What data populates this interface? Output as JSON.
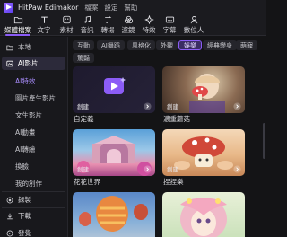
{
  "titlebar": {
    "app_name": "HitPaw Edimakor",
    "menus": [
      "檔案",
      "設定",
      "幫助"
    ]
  },
  "toolbar": {
    "items": [
      {
        "label": "媒體檔案",
        "icon": "folder-icon"
      },
      {
        "label": "文字",
        "icon": "text-icon"
      },
      {
        "label": "素材",
        "icon": "sticker-icon"
      },
      {
        "label": "音訊",
        "icon": "music-icon"
      },
      {
        "label": "轉場",
        "icon": "transition-icon"
      },
      {
        "label": "濾鏡",
        "icon": "filter-icon"
      },
      {
        "label": "特效",
        "icon": "effects-icon"
      },
      {
        "label": "字幕",
        "icon": "subtitle-icon"
      },
      {
        "label": "數位人",
        "icon": "digital-human-icon"
      }
    ]
  },
  "sidebar": {
    "local": "本地",
    "ai_images": "AI影片",
    "subitems": [
      "AI特效",
      "圖片產生影片",
      "文生影片",
      "AI動畫",
      "AI轉繪",
      "換臉",
      "我的創作"
    ],
    "recording": "錄製",
    "download": "下載",
    "bottom_partial": "發覺"
  },
  "tags": {
    "items": [
      "互動",
      "AI舞蹈",
      "風格化",
      "外觀",
      "娛樂",
      "經典變身",
      "萌寵",
      "驚豔"
    ],
    "active": "娛樂"
  },
  "cards": [
    {
      "title": "自定義",
      "create": "創建"
    },
    {
      "title": "濃重蘑菇",
      "create": "創建"
    },
    {
      "title": "花花世界",
      "create": "創建"
    },
    {
      "title": "捏捏樂",
      "create": "創建"
    },
    {
      "title": "",
      "create": ""
    },
    {
      "title": "",
      "create": ""
    }
  ],
  "colors": {
    "accent": "#8b5cf6",
    "background": "#141416",
    "panel": "#1b1b1f"
  }
}
